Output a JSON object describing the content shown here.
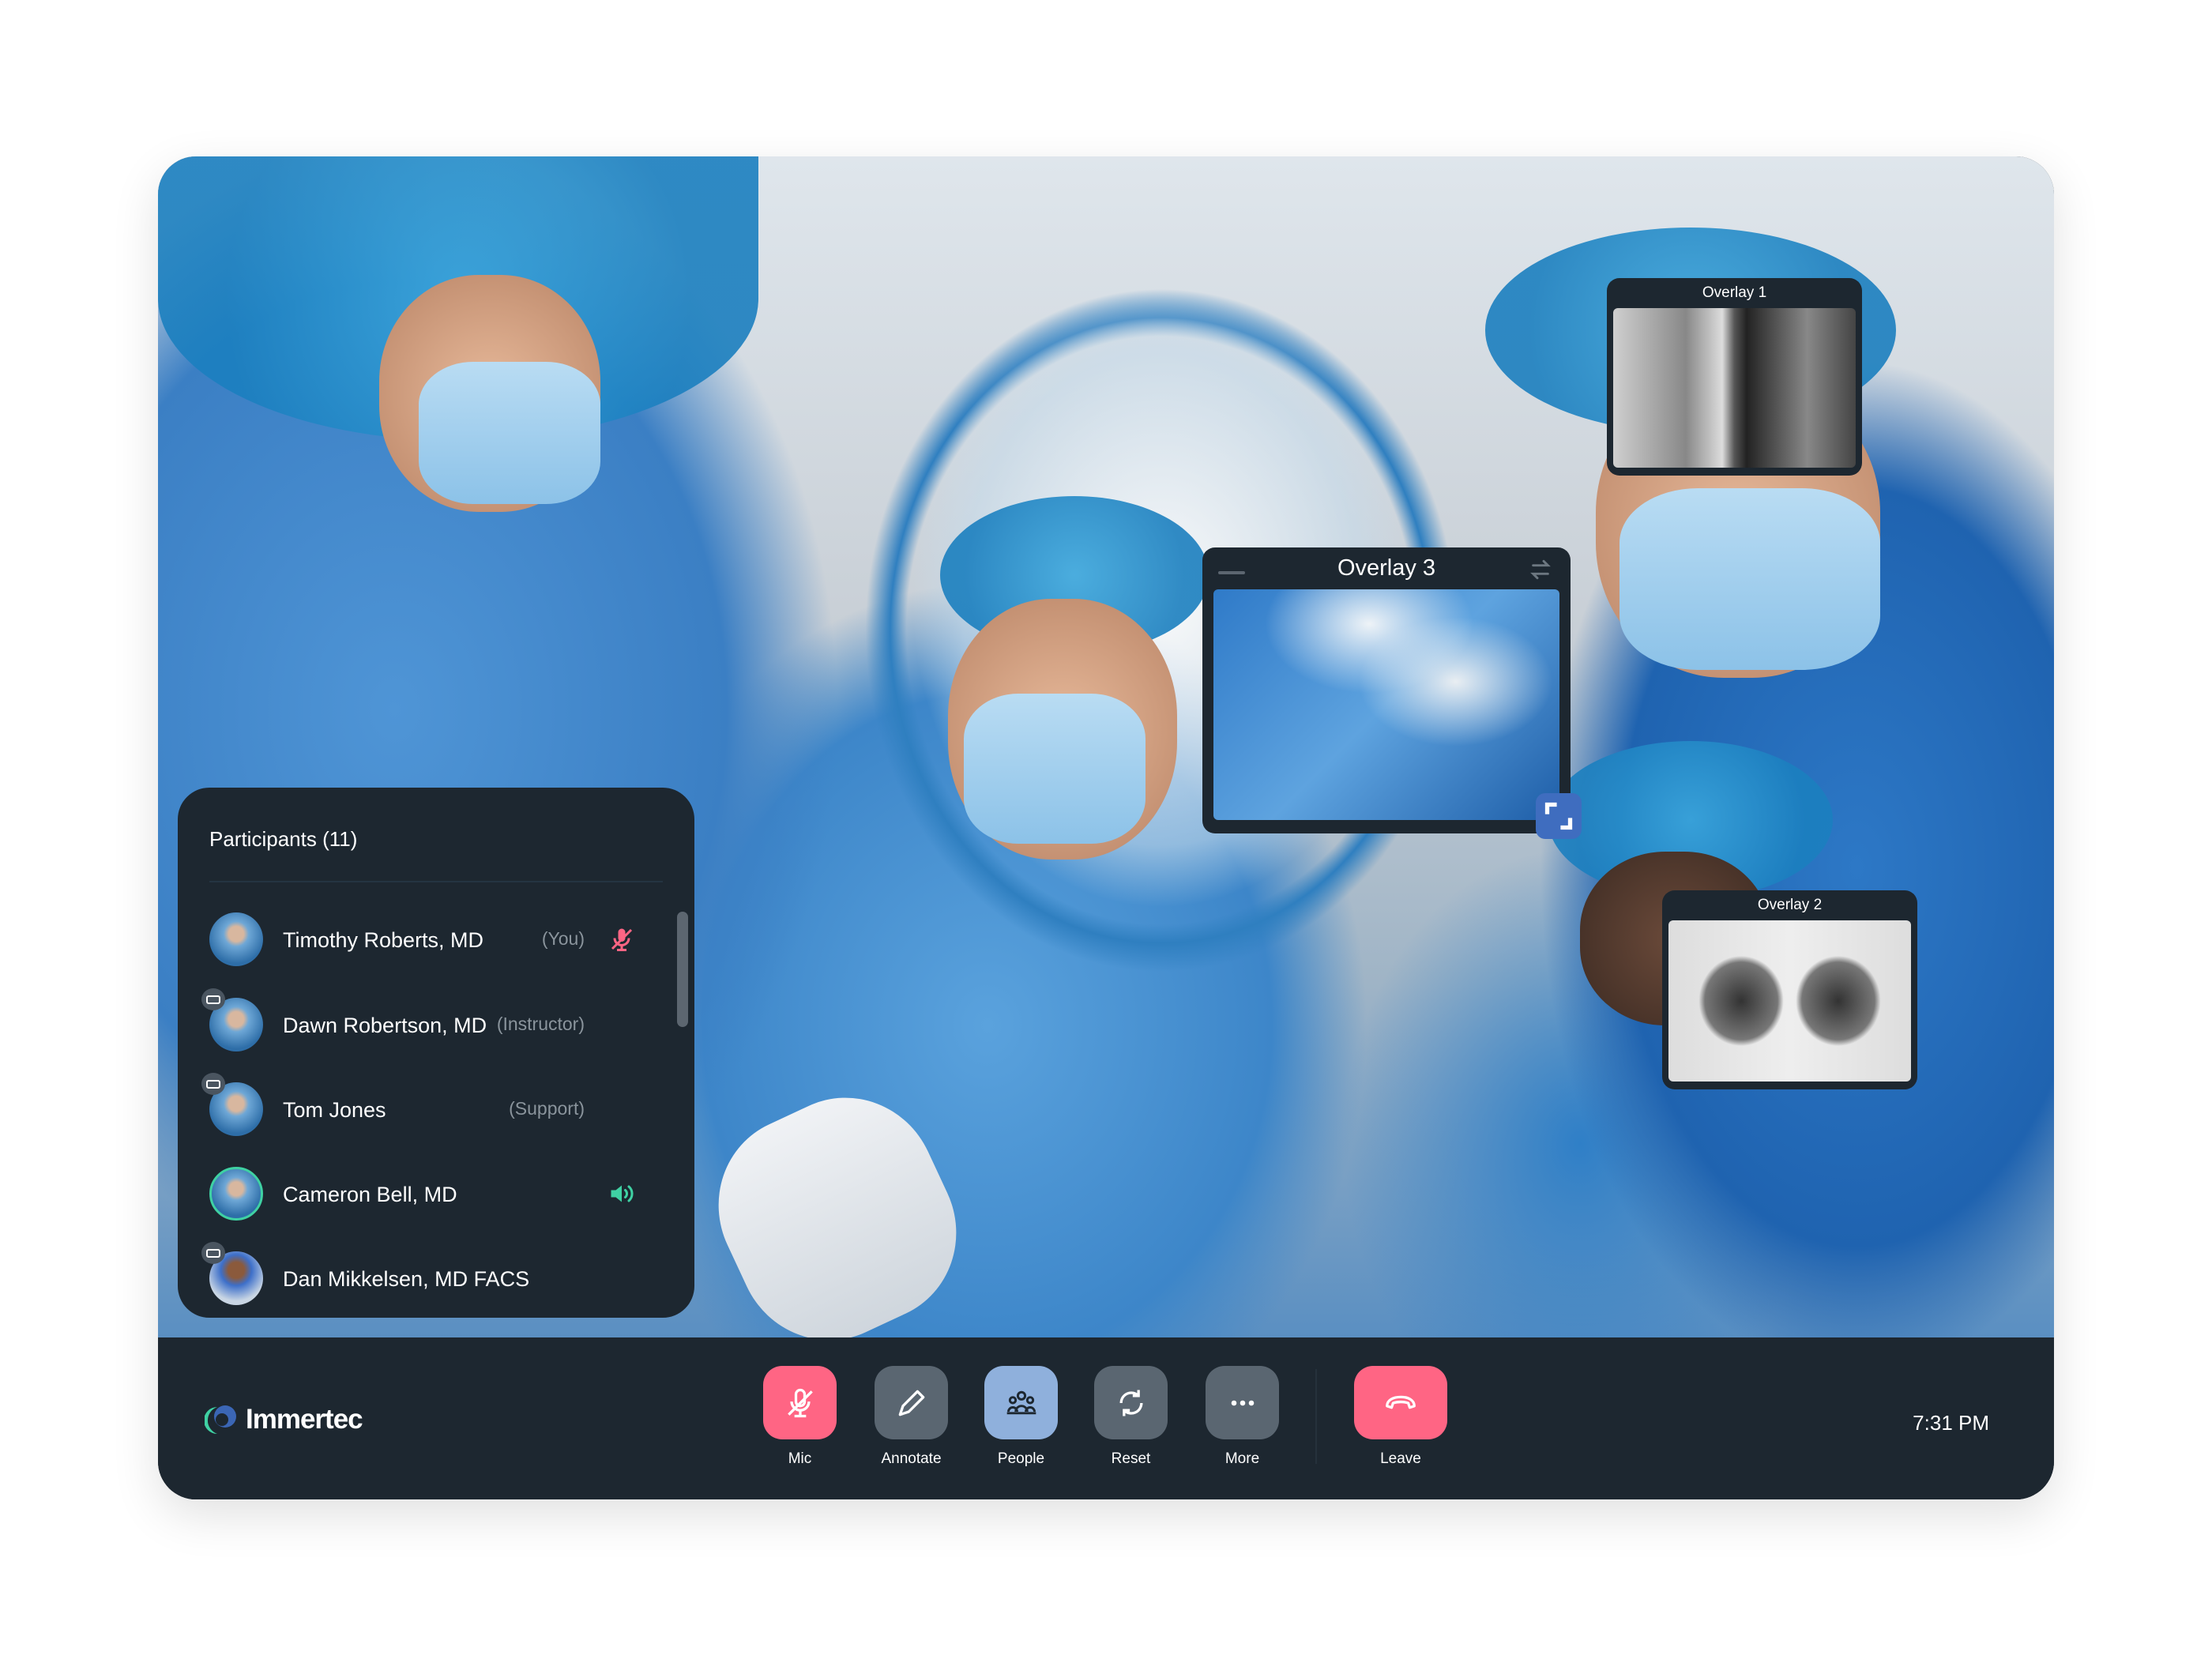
{
  "participants": {
    "title": "Participants (11)",
    "items": [
      {
        "name": "Timothy Roberts, MD",
        "role": "(You)",
        "status": "mic-muted-icon",
        "vr": false
      },
      {
        "name": "Dawn Robertson, MD",
        "role": "(Instructor)",
        "vr": true
      },
      {
        "name": "Tom Jones",
        "role": "(Support)",
        "vr": true
      },
      {
        "name": "Cameron Bell, MD",
        "role": "",
        "status": "speaker-icon",
        "vr": false,
        "speaking": true
      },
      {
        "name": "Dan Mikkelsen, MD FACS",
        "role": "",
        "vr": true
      }
    ]
  },
  "overlays": {
    "o1": "Overlay 1",
    "o2": "Overlay 2",
    "o3": "Overlay 3"
  },
  "toolbar": {
    "mic": "Mic",
    "annotate": "Annotate",
    "people": "People",
    "reset": "Reset",
    "more": "More",
    "leave": "Leave"
  },
  "brand": "Immertec",
  "time": "7:31 PM",
  "colors": {
    "panel": "#1d2730",
    "danger": "#ff6584",
    "neutral": "#5a6671",
    "active": "#8fb0dc",
    "speaking": "#3fd1a3",
    "expand": "#3f6dbf"
  }
}
